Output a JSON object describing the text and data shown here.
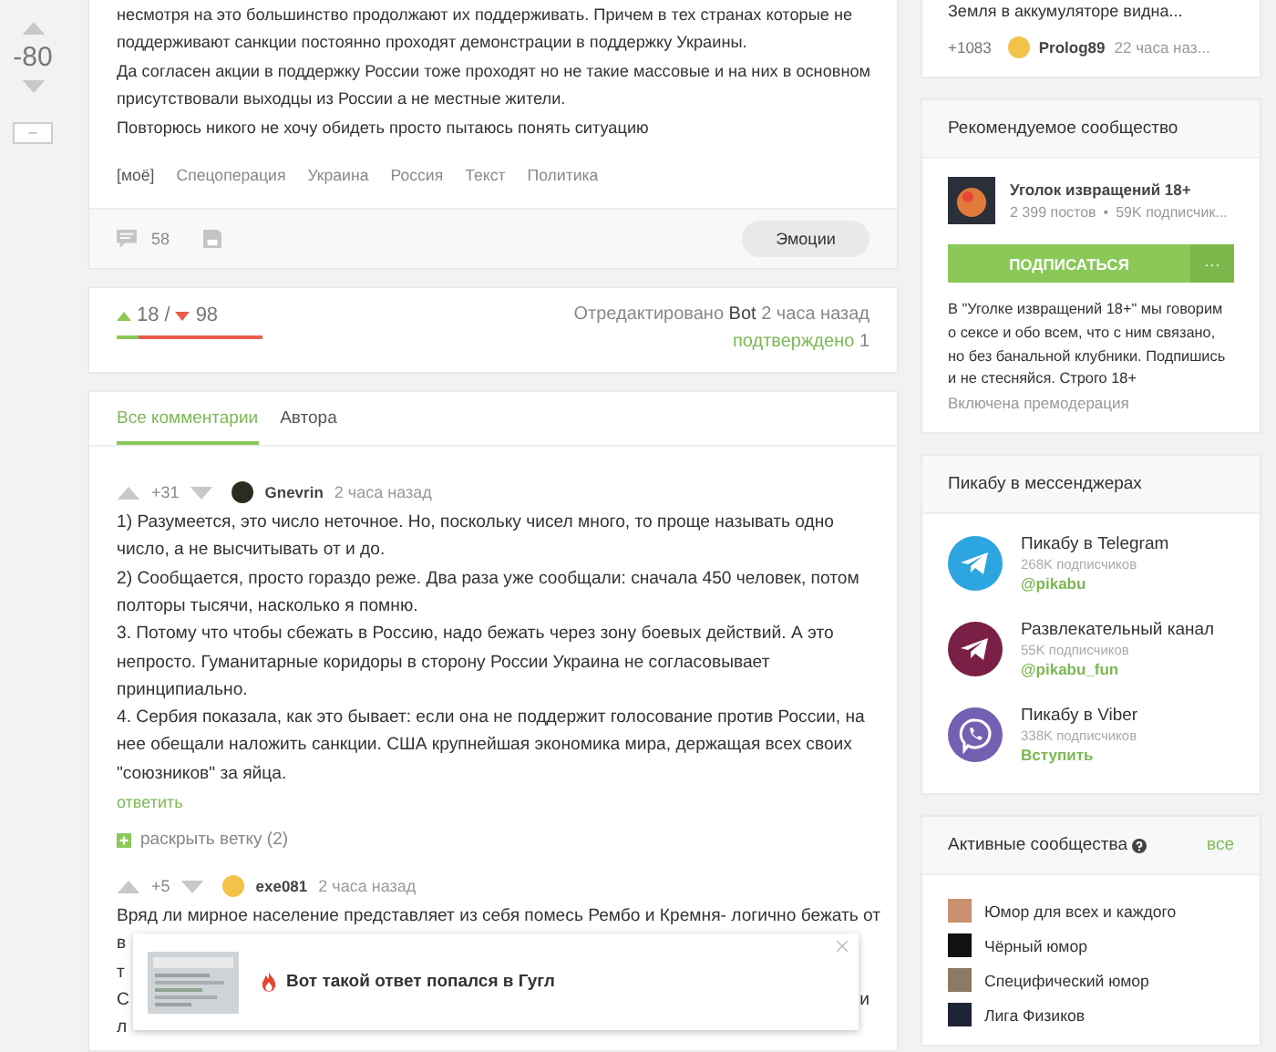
{
  "post": {
    "rating": "-80",
    "collapse": "–",
    "lines": [
      "несмотря на это большинство продолжают их поддерживать. Причем в тех странах которые не",
      "поддерживают санкции постоянно проходят демонстрации в поддержку Украины.",
      "Да согласен акции в поддержку России тоже проходят но не такие массовые и на них в основном",
      "присутствовали выходцы из России а не местные жители.",
      "Повторюсь никого не хочу обидеть просто пытаюсь понять ситуацию"
    ],
    "tags": [
      "[моё]",
      "Спецоперация",
      "Украина",
      "Россия",
      "Текст",
      "Политика"
    ],
    "comments_count": "58",
    "emotions": "Эмоции"
  },
  "votes": {
    "up": "18",
    "sep": "/",
    "down": "98",
    "level": 0.155,
    "edited": "Отредактировано",
    "editor": "Bot",
    "edited_time": "2 часа назад",
    "confirmed": "подтверждено",
    "confirmed_count": "1"
  },
  "tabs": [
    {
      "label": "Все комментарии",
      "selected": true
    },
    {
      "label": "Автора",
      "selected": false
    }
  ],
  "comments": [
    {
      "rating": "+31",
      "author": "Gnevrin",
      "time": "2 часа назад",
      "paragraphs": [
        "1) Разумеется, это число неточное. Но, поскольку чисел много, то проще называть одно число, а не высчитывать от и до.",
        "2) Сообщается, просто гораздо реже. Два раза уже сообщали: сначала 450 человек, потом полторы тысячи, насколько я помню.",
        "3. Потому что чтобы сбежать в Россию, надо бежать через зону боевых действий. А это непросто. Гуманитарные коридоры в сторону России Украина не согласовывает принципиально.",
        "4. Сербия показала, как это бывает: если она не поддержит голосование против России, на нее обещали наложить санкции. США крупнейшая экономика мира, держащая всех своих \"союзников\" за яйца."
      ],
      "reply": "ответить",
      "expand": "раскрыть ветку (2)"
    },
    {
      "rating": "+5",
      "author": "exe081",
      "time": "2 часа назад",
      "paragraphs": [
        "Вряд ли мирное население представляет из себя помесь Рембо и Кремня- логично бежать от",
        "в",
        "т",
        "С",
        "л"
      ],
      "tail": "и"
    }
  ],
  "popup": {
    "text": "Вот такой ответ попался в Гугл"
  },
  "sidebar": {
    "top": {
      "title": "Земля в аккумуляторе видна...",
      "rating": "+1083",
      "author": "Prolog89",
      "time": "22 часа наз..."
    },
    "recommended": {
      "header": "Рекомендуемое сообщество",
      "name": "Уголок извращений 18+",
      "posts": "2 399 постов",
      "dot": "•",
      "subs": "59K подписчик...",
      "subscribe": "ПОДПИСАТЬСЯ",
      "more": "···",
      "description": "В \"Уголке извращений 18+\" мы говорим о сексе и обо всем, что с ним связано, но без банальной клубники. Подпишись и не стесняйся. Строго 18+",
      "moderation": "Включена премодерация"
    },
    "messengers": {
      "header": "Пикабу в мессенджерах",
      "items": [
        {
          "kind": "telegram",
          "color": "#2ca5e0",
          "name": "Пикабу в Telegram",
          "subs": "268K подписчиков",
          "link": "@pikabu"
        },
        {
          "kind": "telegram",
          "color": "#7a1f45",
          "name": "Развлекательный канал",
          "subs": "55K подписчиков",
          "link": "@pikabu_fun"
        },
        {
          "kind": "viber",
          "color": "#7360b2",
          "name": "Пикабу в Viber",
          "subs": "338K подписчиков",
          "link": "Вступить"
        }
      ]
    },
    "active": {
      "header": "Активные сообщества",
      "all": "все",
      "items": [
        {
          "name": "Юмор для всех и каждого",
          "color": "#c98f6e"
        },
        {
          "name": "Чёрный юмор",
          "color": "#111111"
        },
        {
          "name": "Специфический юмор",
          "color": "#8a7a66"
        },
        {
          "name": "Лига Физиков",
          "color": "#1d2433"
        }
      ]
    }
  }
}
